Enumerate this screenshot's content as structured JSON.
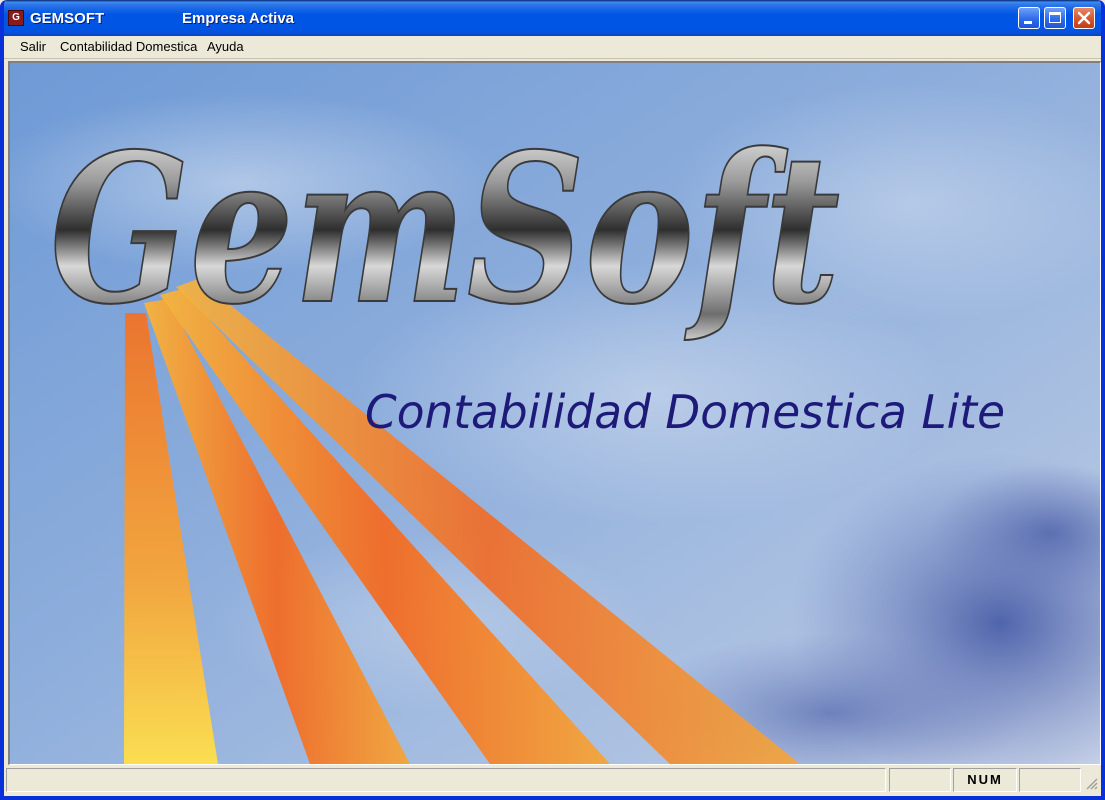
{
  "window": {
    "app_name": "GEMSOFT",
    "company_status": "Empresa Activa",
    "icon_letter": "G",
    "icon": "app-icon"
  },
  "titlebar_buttons": {
    "minimize_icon": "minimize-icon",
    "maximize_icon": "maximize-icon",
    "close_icon": "close-icon"
  },
  "menu": {
    "items": [
      {
        "label": "Salir"
      },
      {
        "label": "Contabilidad Domestica"
      },
      {
        "label": "Ayuda"
      }
    ]
  },
  "splash": {
    "logo_text": "GemSoft",
    "subtitle": "Contabilidad Domestica Lite"
  },
  "statusbar": {
    "message": "",
    "panes": [
      "",
      "NUM",
      ""
    ]
  },
  "colors": {
    "titlebar": "#0055E5",
    "sky": "#7FA3D8",
    "subtitle": "#1E1A7A",
    "beams": "#F07A22"
  }
}
